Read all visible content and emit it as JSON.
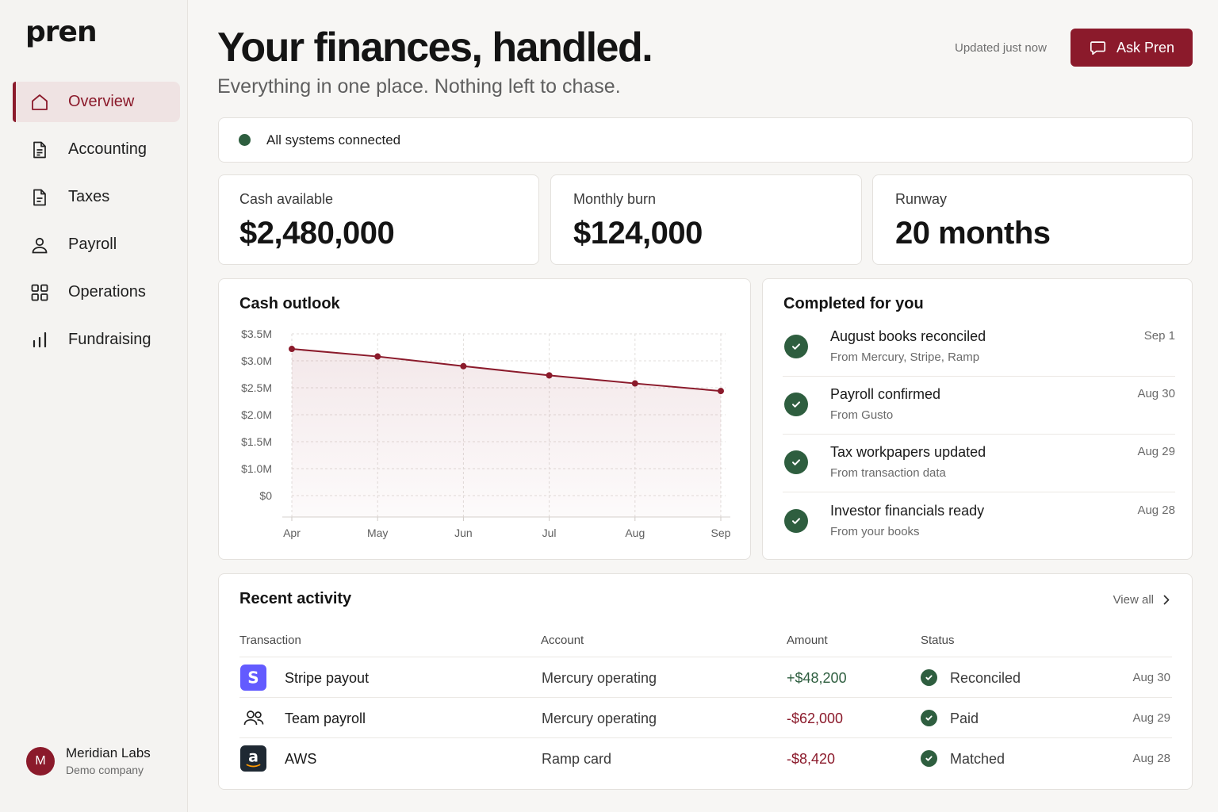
{
  "app": {
    "logo": "pren"
  },
  "sidebar": {
    "items": [
      {
        "label": "Overview",
        "icon": "home-icon",
        "active": true
      },
      {
        "label": "Accounting",
        "icon": "document-icon"
      },
      {
        "label": "Taxes",
        "icon": "tax-document-icon"
      },
      {
        "label": "Payroll",
        "icon": "person-icon"
      },
      {
        "label": "Operations",
        "icon": "grid-icon"
      },
      {
        "label": "Fundraising",
        "icon": "bar-chart-icon"
      }
    ],
    "company": {
      "initial": "M",
      "name": "Meridian Labs",
      "subtitle": "Demo company"
    }
  },
  "header": {
    "title": "Your finances, handled.",
    "subtitle": "Everything in one place. Nothing left to chase.",
    "updated": "Updated just now",
    "ask_button": "Ask Pren"
  },
  "status": {
    "text": "All systems connected",
    "color": "#2e5e3f"
  },
  "metrics": [
    {
      "label": "Cash available",
      "value": "$2,480,000"
    },
    {
      "label": "Monthly burn",
      "value": "$124,000"
    },
    {
      "label": "Runway",
      "value": "20 months"
    }
  ],
  "cash_outlook": {
    "title": "Cash outlook"
  },
  "chart_data": {
    "type": "area",
    "title": "Cash outlook",
    "categories": [
      "Apr",
      "May",
      "Jun",
      "Jul",
      "Aug",
      "Sep"
    ],
    "y_ticks": [
      "$3.5M",
      "$3.0M",
      "$2.5M",
      "$2.0M",
      "$1.5M",
      "$1.0M",
      "$0"
    ],
    "series": [
      {
        "values": [
          3.22,
          3.08,
          2.9,
          2.73,
          2.58,
          2.44
        ]
      }
    ],
    "color": "#8b1a2b",
    "grid": true
  },
  "completed": {
    "title": "Completed for you",
    "items": [
      {
        "title": "August books reconciled",
        "subtitle": "From Mercury, Stripe, Ramp",
        "date": "Sep 1"
      },
      {
        "title": "Payroll confirmed",
        "subtitle": "From Gusto",
        "date": "Aug 30"
      },
      {
        "title": "Tax workpapers updated",
        "subtitle": "From transaction data",
        "date": "Aug 29"
      },
      {
        "title": "Investor financials ready",
        "subtitle": "From your books",
        "date": "Aug 28"
      }
    ]
  },
  "activity": {
    "title": "Recent activity",
    "view_all": "View all",
    "columns": [
      "Transaction",
      "Account",
      "Amount",
      "Status"
    ],
    "rows": [
      {
        "icon": "stripe-icon",
        "name": "Stripe payout",
        "account": "Mercury operating",
        "amount": "+$48,200",
        "status": "Reconciled",
        "date": "Aug 30"
      },
      {
        "icon": "people-icon",
        "name": "Team payroll",
        "account": "Mercury operating",
        "amount": "-$62,000",
        "status": "Paid",
        "date": "Aug 29"
      },
      {
        "icon": "amazon-icon",
        "name": "AWS",
        "account": "Ramp card",
        "amount": "-$8,420",
        "status": "Matched",
        "date": "Aug 28"
      }
    ]
  },
  "colors": {
    "accent": "#8b1a2b",
    "positive": "#2e5e3f",
    "negative": "#8b1a2b"
  }
}
